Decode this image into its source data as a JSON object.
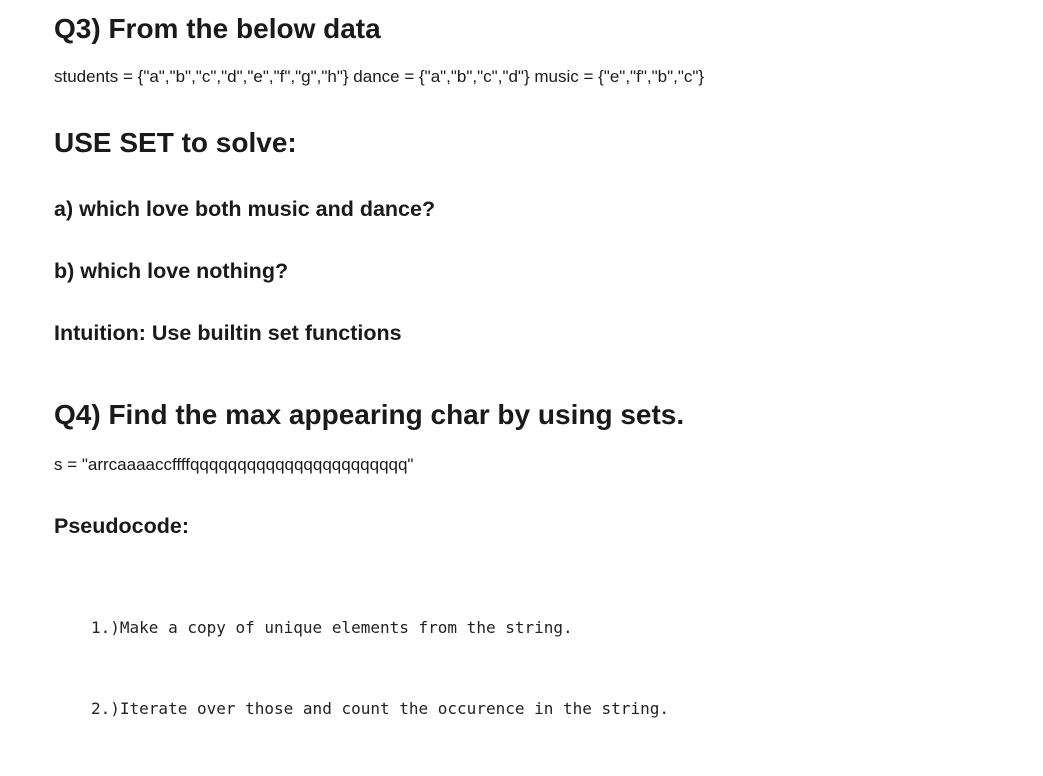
{
  "q3": {
    "heading": "Q3) From the below data",
    "data_line": "students = {\"a\",\"b\",\"c\",\"d\",\"e\",\"f\",\"g\",\"h\"} dance = {\"a\",\"b\",\"c\",\"d\"} music = {\"e\",\"f\",\"b\",\"c\"}",
    "instruction_heading": "USE SET to solve:",
    "question_a": "a) which love both music and dance?",
    "question_b": "b) which love nothing?",
    "intuition": "Intuition: Use builtin set functions"
  },
  "q4": {
    "heading": "Q4) Find the max appearing char by using sets.",
    "string_line": "s = \"arrcaaaaccffffqqqqqqqqqqqqqqqqqqqqqqq\"",
    "pseudocode_heading": "Pseudocode:",
    "steps": [
      "1.)Make a copy of unique elements from the string.",
      "2.)Iterate over those and count the occurence in the string."
    ]
  }
}
